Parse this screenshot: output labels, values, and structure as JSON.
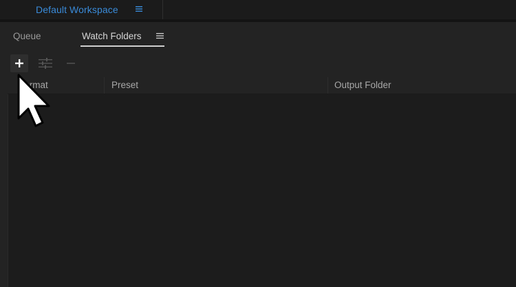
{
  "workspace": {
    "label": "Default Workspace",
    "menu_icon": "hamburger-menu-icon",
    "accent_color": "#3a8bd9"
  },
  "panel": {
    "tabs": [
      {
        "label": "Queue",
        "active": false
      },
      {
        "label": "Watch Folders",
        "active": true
      }
    ],
    "menu_icon": "hamburger-menu-icon"
  },
  "toolbar": {
    "buttons": [
      {
        "name": "add-folder",
        "icon": "plus-icon",
        "enabled": true
      },
      {
        "name": "settings",
        "icon": "sliders-icon",
        "enabled": false
      },
      {
        "name": "remove",
        "icon": "minus-icon",
        "enabled": false
      }
    ]
  },
  "table": {
    "columns": [
      "Format",
      "Preset",
      "Output Folder"
    ],
    "rows": []
  }
}
